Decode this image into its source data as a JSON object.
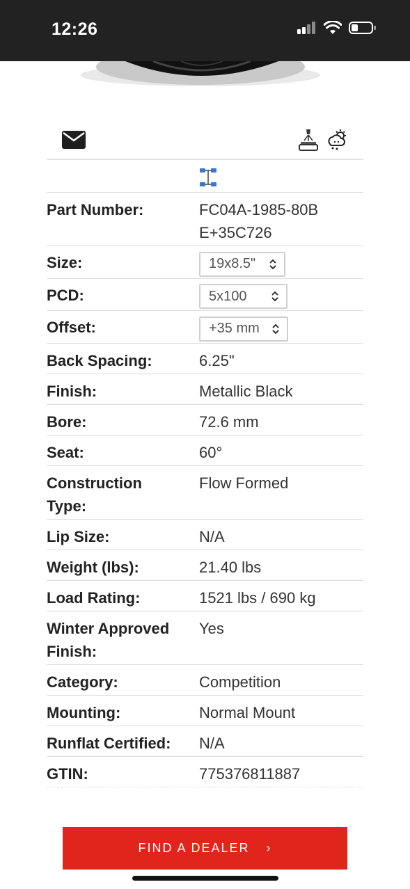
{
  "status_bar": {
    "time": "12:26"
  },
  "icons": {
    "mail": "envelope-icon",
    "powder_coat": "powder-coat-icon",
    "weather": "snow-weather-icon",
    "axle": "axle-fitment-icon"
  },
  "specs": [
    {
      "label": "Part Number:",
      "value": "FC04A-1985-80BE+35C726"
    },
    {
      "label": "Size:",
      "value": "19x8.5\"",
      "type": "select"
    },
    {
      "label": "PCD:",
      "value": "5x100",
      "type": "select"
    },
    {
      "label": "Offset:",
      "value": "+35 mm",
      "type": "select"
    },
    {
      "label": "Back Spacing:",
      "value": "6.25\""
    },
    {
      "label": "Finish:",
      "value": "Metallic Black"
    },
    {
      "label": "Bore:",
      "value": "72.6 mm"
    },
    {
      "label": "Seat:",
      "value": "60°"
    },
    {
      "label": "Construction Type:",
      "value": "Flow Formed"
    },
    {
      "label": "Lip Size:",
      "value": "N/A"
    },
    {
      "label": "Weight (lbs):",
      "value": "21.40 lbs"
    },
    {
      "label": "Load Rating:",
      "value": "1521 lbs / 690 kg"
    },
    {
      "label": "Winter Approved Finish:",
      "value": "Yes"
    },
    {
      "label": "Category:",
      "value": "Competition"
    },
    {
      "label": "Mounting:",
      "value": "Normal Mount"
    },
    {
      "label": "Runflat Certified:",
      "value": "N/A"
    },
    {
      "label": "GTIN:",
      "value": "775376811887"
    }
  ],
  "cta": {
    "label": "FIND A DEALER",
    "arrow": "›",
    "color": "#e0261c"
  }
}
